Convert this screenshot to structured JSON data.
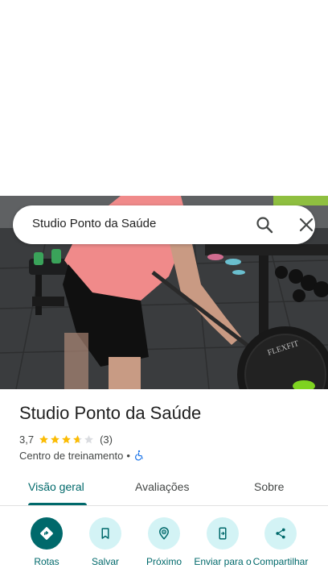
{
  "search": {
    "query": "Studio Ponto da Saúde"
  },
  "place": {
    "name": "Studio Ponto da Saúde",
    "rating": "3,7",
    "rating_stars": 3.7,
    "review_count": "(3)",
    "category": "Centro de treinamento",
    "separator": "•"
  },
  "photo": {
    "plate_text": "FLEXFIT"
  },
  "tabs": [
    {
      "label": "Visão geral",
      "active": true
    },
    {
      "label": "Avaliações",
      "active": false
    },
    {
      "label": "Sobre",
      "active": false
    }
  ],
  "actions": [
    {
      "label": "Rotas",
      "icon": "directions-icon"
    },
    {
      "label": "Salvar",
      "icon": "bookmark-icon"
    },
    {
      "label": "Próximo",
      "icon": "nearby-icon"
    },
    {
      "label": "Enviar para o",
      "icon": "send-to-phone-icon"
    },
    {
      "label": "Compartilhar",
      "icon": "share-icon"
    }
  ],
  "colors": {
    "accent": "#00696b",
    "accent_light": "#d3f3f5",
    "star": "#fbbc04",
    "wheelchair": "#1a73e8"
  }
}
